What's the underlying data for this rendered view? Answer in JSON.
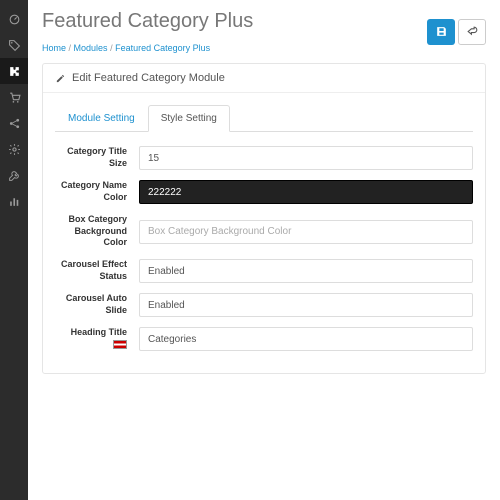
{
  "header": {
    "title": "Featured Category Plus",
    "breadcrumbs": [
      "Home",
      "Modules",
      "Featured Category Plus"
    ]
  },
  "panel": {
    "title": "Edit Featured Category Module"
  },
  "tabs": [
    {
      "label": "Module Setting",
      "active": false
    },
    {
      "label": "Style Setting",
      "active": true
    }
  ],
  "form": {
    "category_title_size": {
      "label": "Category Title Size",
      "value": "15"
    },
    "category_name_color": {
      "label": "Category Name Color",
      "value": "222222",
      "bg": "#222222"
    },
    "box_bg_color": {
      "label": "Box Category Background Color",
      "placeholder": "Box Category Background Color",
      "value": ""
    },
    "carousel_effect": {
      "label": "Carousel Effect Status",
      "value": "Enabled"
    },
    "carousel_auto": {
      "label": "Carousel Auto Slide",
      "value": "Enabled"
    },
    "heading_title": {
      "label": "Heading Title",
      "value": "Categories"
    }
  },
  "colors": {
    "primary": "#1e91cf",
    "sidebar": "#2c2c2c"
  }
}
